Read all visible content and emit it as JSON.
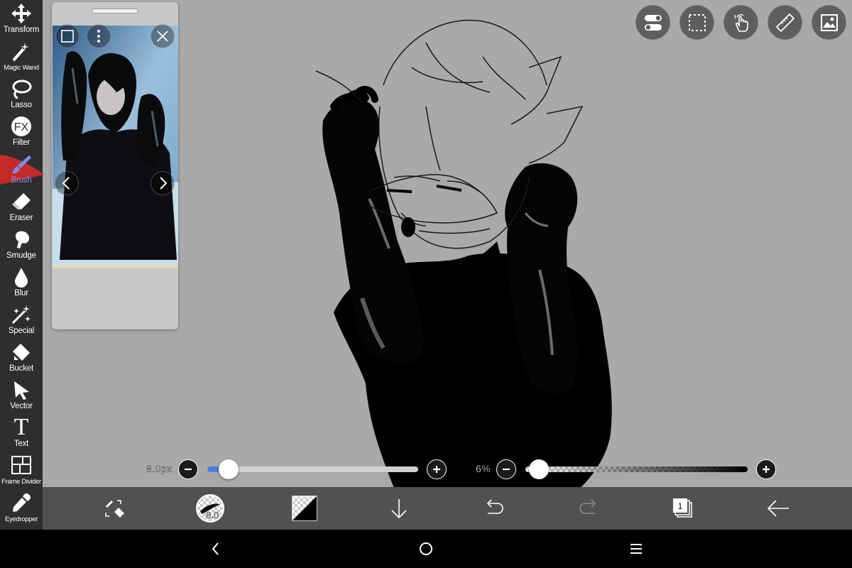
{
  "toolbar": {
    "items": [
      {
        "label": "Transform",
        "icon": "transform-icon"
      },
      {
        "label": "Magic Wand",
        "icon": "magic-wand-icon"
      },
      {
        "label": "Lasso",
        "icon": "lasso-icon"
      },
      {
        "label": "Filter",
        "icon": "fx-icon",
        "glyph": "FX"
      },
      {
        "label": "Brush",
        "icon": "brush-icon",
        "active": true
      },
      {
        "label": "Eraser",
        "icon": "eraser-icon"
      },
      {
        "label": "Smudge",
        "icon": "smudge-icon"
      },
      {
        "label": "Blur",
        "icon": "blur-drop-icon"
      },
      {
        "label": "Special",
        "icon": "sparkle-icon"
      },
      {
        "label": "Bucket",
        "icon": "bucket-icon"
      },
      {
        "label": "Vector",
        "icon": "vector-arrow-icon"
      },
      {
        "label": "Text",
        "icon": "text-icon",
        "glyph": "T"
      },
      {
        "label": "Frame Divider",
        "icon": "frame-divider-icon"
      },
      {
        "label": "Eyedropper",
        "icon": "eyedropper-icon"
      }
    ],
    "active_color": "#7d8ff5"
  },
  "top_buttons": [
    {
      "name": "toggle-icon"
    },
    {
      "name": "selection-icon"
    },
    {
      "name": "hand-gesture-icon"
    },
    {
      "name": "ruler-icon"
    },
    {
      "name": "image-icon"
    }
  ],
  "brush_size": {
    "value_text": "8.0px",
    "fraction": 0.1
  },
  "opacity": {
    "value_text": "6%",
    "fraction": 0.06
  },
  "bottom_bar": {
    "brush_size_badge": "8.0",
    "layer_count": "1"
  },
  "colors": {
    "canvas": "#a9a9a9",
    "toolbar": "#2e2e2e",
    "bottom_bar": "#515151",
    "slider_blue": "#4a7ee0"
  }
}
